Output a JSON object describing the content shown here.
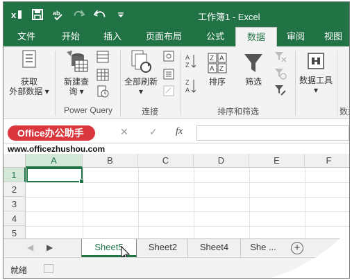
{
  "titlebar": {
    "title": "工作簿1 - Excel",
    "qat": {
      "icon_excel": "excel-icon",
      "icon_save": "save-icon",
      "icon_spell": "spell-check-icon",
      "icon_redo": "redo-icon",
      "icon_undo": "undo-icon",
      "icon_customize": "customize-qat-icon"
    }
  },
  "tabs": [
    {
      "label": "文件"
    },
    {
      "label": "开始"
    },
    {
      "label": "插入"
    },
    {
      "label": "页面布局"
    },
    {
      "label": "公式"
    },
    {
      "label": "数据"
    },
    {
      "label": "审阅"
    },
    {
      "label": "视图"
    }
  ],
  "active_tab": "数据",
  "ribbon": {
    "get_external": {
      "line1": "获取",
      "line2": "外部数据 ▾"
    },
    "new_query": {
      "line1": "新建查",
      "line2": "询 ▾"
    },
    "group_power_query": "Power Query",
    "refresh_all": {
      "line1": "全部刷新",
      "line2": "▾"
    },
    "group_connections": "连接",
    "sort_btn": "排序",
    "filter_btn": "筛选",
    "group_sort_filter": "排序和筛选",
    "data_tools": {
      "line1": "数据工具",
      "line2": "▾"
    },
    "group_truncated": "数据"
  },
  "formula_bar": {
    "name_box": "Office办公助手",
    "cancel": "✕",
    "enter": "✓",
    "fx": "fx",
    "value": ""
  },
  "watermark": "www.officezhushou.com",
  "grid": {
    "columns": [
      "A",
      "B",
      "C",
      "D",
      "E",
      "F"
    ],
    "rows": [
      "1",
      "2",
      "3",
      "4",
      "5"
    ],
    "active_cell": "A1"
  },
  "sheets": {
    "tabs": [
      "Sheet5",
      "Sheet2",
      "Sheet4",
      "She ..."
    ],
    "active": "Sheet5",
    "nav_prev": "◀",
    "nav_next": "▶",
    "add": "+"
  },
  "status": {
    "text": "就绪"
  },
  "colors": {
    "accent": "#217346",
    "namebox": "#d9363e"
  }
}
